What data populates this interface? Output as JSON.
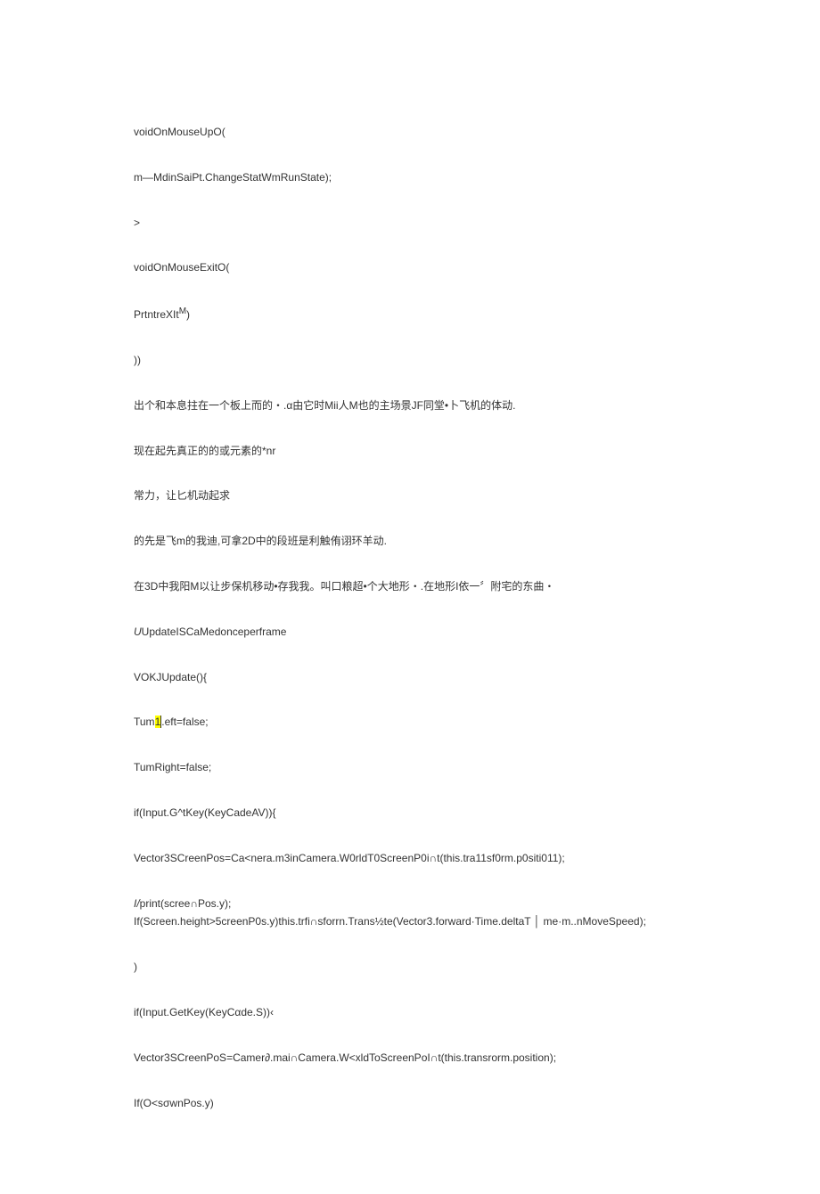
{
  "lines": [
    {
      "text": "voidOnMouseUpO(",
      "cls": "para"
    },
    {
      "text": "m—MdinSaiPt.ChangeStatWmRunState);",
      "cls": "para"
    },
    {
      "text": ">",
      "cls": "para"
    },
    {
      "text": "voidOnMouseExitO(",
      "cls": "para"
    },
    {
      "text": "PrtntreXIt",
      "sup": "M",
      "after": ")",
      "cls": "para"
    },
    {
      "text": "))",
      "cls": "para"
    },
    {
      "text": "出个和本息拄在一个板上而的・.α由它时Mii人M也的主场景JF同堂•卜飞机的体动.",
      "cls": "para"
    },
    {
      "text": "现在起先真正的的或元素的*nr",
      "cls": "para"
    },
    {
      "text": "常力，让匕机动起求",
      "cls": "para"
    },
    {
      "text": "的先是飞m的我迪,可拿2D中的段班是利触侑诩环羊动.",
      "cls": "para"
    },
    {
      "text": "在3D中我阳M以让步保机移动•存我我。叫口粮超•个大地形・.在地形I依一〞附宅的东曲・",
      "cls": "para"
    },
    {
      "pre_italic": "U",
      "text": "UpdateISCaMedonceperframe",
      "cls": "para"
    },
    {
      "text": "VOKJUpdate(){",
      "cls": "para"
    },
    {
      "pre": "Tum",
      "hl": "1",
      "cursor": true,
      "post": ".eft=false;",
      "cls": "para"
    },
    {
      "text": "TumRight=false;",
      "cls": "para"
    },
    {
      "text": "if(Input.G^tKey(KeyCadeAV)){",
      "cls": "para"
    },
    {
      "text": "Vector3SCreenPos=Ca<nera.m3inCamera.W0rldT0ScreenP0i∩t(this.tra11sf0rm.p0siti011);",
      "cls": "para"
    },
    {
      "pre_italic": "I/",
      "text": "print(scree∩Pos.y);",
      "cls": "para-tight"
    },
    {
      "text": "If(Screen.height>5creenP0s.y)this.trfi∩sforrn.Trans½te(Vector3.forward·Time.deltaT │ me·m..nMoveSpeed);",
      "cls": "para"
    },
    {
      "text": ")",
      "cls": "para"
    },
    {
      "text": "if(Input.GetKey(KeyCαde.S))‹",
      "cls": "para"
    },
    {
      "text": "Vector3SCreenPoS=Camer∂.mai∩Camera.W<xldToScreenPoI∩t(this.transrorm.position);",
      "cls": "para"
    },
    {
      "text": "If(O<sσwnPos.y)",
      "cls": "para"
    }
  ]
}
